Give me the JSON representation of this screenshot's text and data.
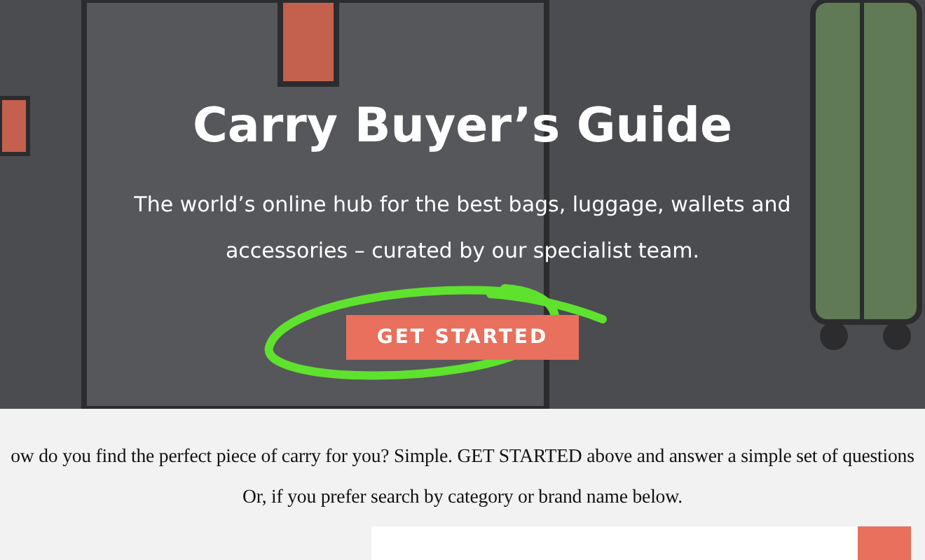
{
  "hero": {
    "title": "Carry Buyer’s Guide",
    "subtitle": "The world’s online hub for the best bags, luggage, wallets and accessories – curated by our specialist team.",
    "button": "GET STARTED"
  },
  "intro": {
    "lines": [
      "ow do you find the perfect piece of carry for you? Simple. GET STARTED above and answer a simple set of questions",
      "Or, if you prefer search by category or brand name below."
    ]
  }
}
